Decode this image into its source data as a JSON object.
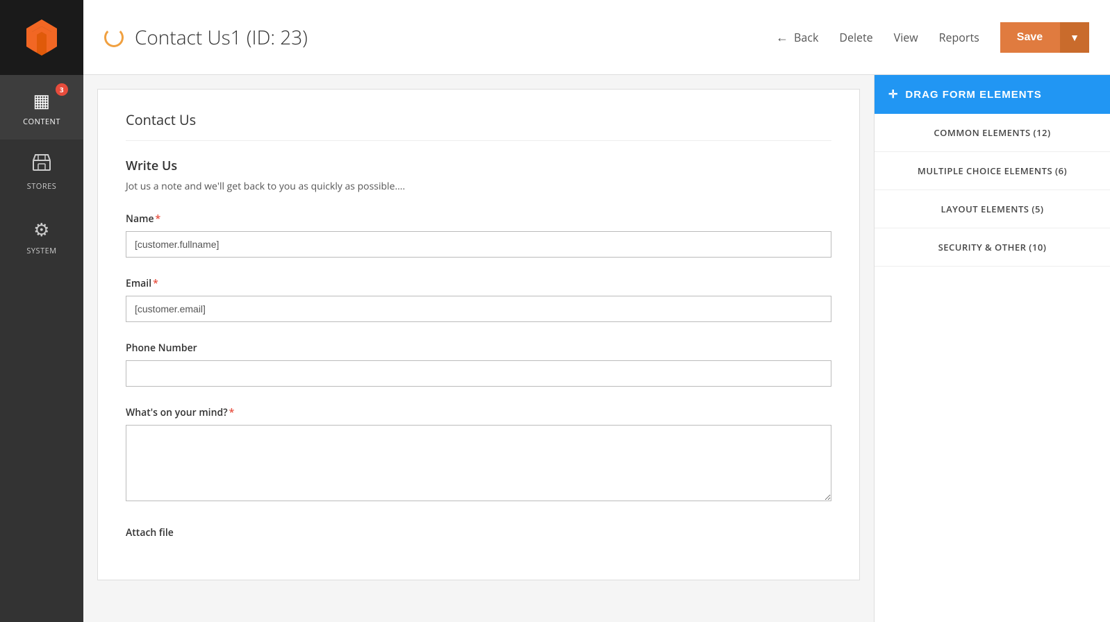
{
  "sidebar": {
    "logo_alt": "Magento Logo",
    "items": [
      {
        "id": "content",
        "label": "CONTENT",
        "icon": "▦",
        "badge": 3,
        "active": true
      },
      {
        "id": "stores",
        "label": "STORES",
        "icon": "🏪",
        "badge": null
      },
      {
        "id": "system",
        "label": "SYSTEM",
        "icon": "⚙",
        "badge": null
      }
    ]
  },
  "topbar": {
    "title": "Contact Us1 (ID: 23)",
    "back_label": "Back",
    "delete_label": "Delete",
    "view_label": "View",
    "reports_label": "Reports",
    "save_label": "Save"
  },
  "form": {
    "card_title": "Contact Us",
    "section_title": "Write Us",
    "section_desc": "Jot us a note and we'll get back to you as quickly as possible....",
    "fields": [
      {
        "id": "name",
        "label": "Name",
        "required": true,
        "value": "[customer.fullname]",
        "type": "text"
      },
      {
        "id": "email",
        "label": "Email",
        "required": true,
        "value": "[customer.email]",
        "type": "text"
      },
      {
        "id": "phone",
        "label": "Phone Number",
        "required": false,
        "value": "",
        "type": "text"
      },
      {
        "id": "mind",
        "label": "What's on your mind?",
        "required": true,
        "value": "",
        "type": "textarea"
      }
    ],
    "attach_label": "Attach file"
  },
  "right_panel": {
    "drag_btn_label": "DRAG FORM ELEMENTS",
    "groups": [
      {
        "id": "common",
        "label": "COMMON ELEMENTS (12)"
      },
      {
        "id": "multiple",
        "label": "MULTIPLE CHOICE ELEMENTS (6)"
      },
      {
        "id": "layout",
        "label": "LAYOUT ELEMENTS (5)"
      },
      {
        "id": "security",
        "label": "SECURITY & OTHER (10)"
      }
    ]
  }
}
